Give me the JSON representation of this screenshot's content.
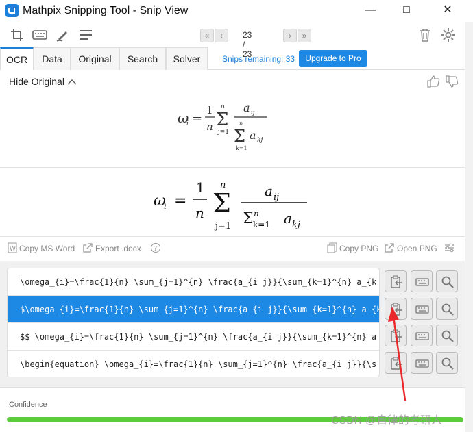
{
  "window": {
    "title": "Mathpix Snipping Tool - Snip View",
    "icon_letter": "µ",
    "minimize": "—",
    "maximize": "□",
    "close": "✕"
  },
  "toolbar": {
    "icons": [
      "crop-snip-icon",
      "keyboard-icon",
      "draw-icon",
      "menu-lines-icon"
    ],
    "pager": {
      "first": "«",
      "prev": "‹",
      "count": "23 / 23",
      "next": "›",
      "last": "»"
    },
    "right_icons": [
      "trash-icon",
      "settings-gear-icon"
    ]
  },
  "tabs": [
    {
      "label": "OCR",
      "active": true
    },
    {
      "label": "Data",
      "active": false
    },
    {
      "label": "Original",
      "active": false
    },
    {
      "label": "Search",
      "active": false
    },
    {
      "label": "Solver",
      "active": false
    }
  ],
  "snips_remaining": "Snips remaining: 33",
  "upgrade_label": "Upgrade to Pro",
  "original": {
    "toggle_label": "Hide Original",
    "feedback_icons": [
      "thumbs-up-icon",
      "thumbs-down-icon"
    ]
  },
  "formula": {
    "lhs": "ω",
    "lhs_sub": "i",
    "one": "1",
    "n": "n",
    "sum_lower": "j=1",
    "sum_upper": "n",
    "num": "a",
    "num_sub": "ij",
    "den_sum_lower": "k=1",
    "den_sum_upper": "n",
    "den": "a",
    "den_sub": "kj"
  },
  "copybar": {
    "copy_ms_word": "Copy MS Word",
    "export_docx": "Export .docx",
    "copy_png": "Copy PNG",
    "open_png": "Open PNG"
  },
  "latex_rows": [
    {
      "text": "\\omega_{i}=\\frac{1}{n} \\sum_{j=1}^{n} \\frac{a_{i j}}{\\sum_{k=1}^{n} a_{k",
      "selected": false
    },
    {
      "text": "$\\omega_{i}=\\frac{1}{n} \\sum_{j=1}^{n} \\frac{a_{i j}}{\\sum_{k=1}^{n} a_{k",
      "selected": true
    },
    {
      "text": "$$  \\omega_{i}=\\frac{1}{n} \\sum_{j=1}^{n} \\frac{a_{i j}}{\\sum_{k=1}^{n} a",
      "selected": false
    },
    {
      "text": "\\begin{equation}  \\omega_{i}=\\frac{1}{n} \\sum_{j=1}^{n} \\frac{a_{i j}}{\\s",
      "selected": false
    }
  ],
  "confidence": {
    "label": "Confidence",
    "value": 1.0,
    "color": "#5ccc3e"
  },
  "watermark": "CSDN @自律的考研人",
  "colors": {
    "accent": "#1e88e5",
    "arrow": "#e8282a"
  }
}
